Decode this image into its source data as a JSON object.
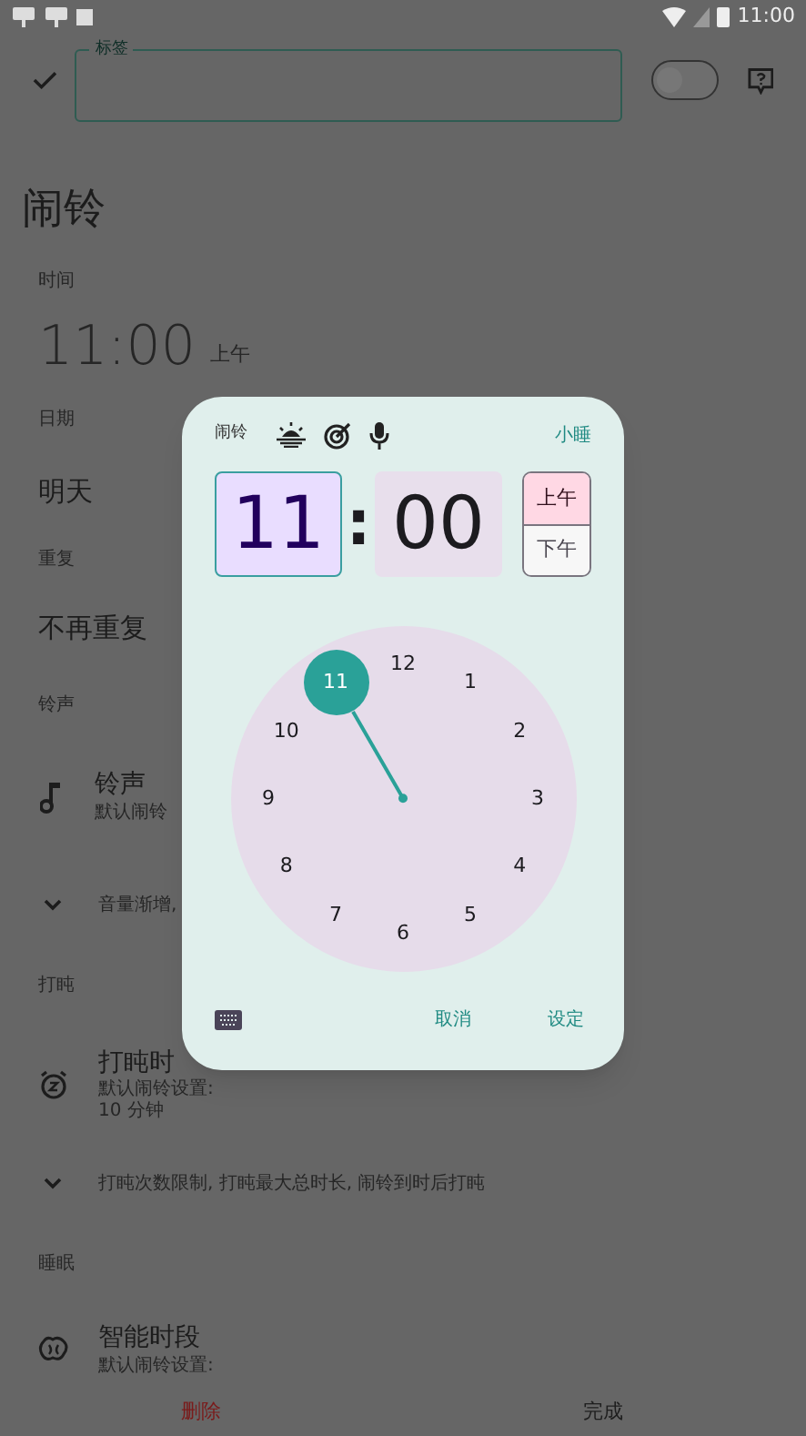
{
  "status_bar": {
    "time": "11:00"
  },
  "label_field": {
    "label": "标签"
  },
  "toggle": {
    "on": false
  },
  "title": "闹铃",
  "time": {
    "header": "时间",
    "value": "11:00",
    "period": "上午"
  },
  "date": {
    "header": "日期",
    "value": "明天"
  },
  "repeat": {
    "header": "重复",
    "value": "不再重复"
  },
  "ringtone": {
    "header": "铃声",
    "title": "铃声",
    "subtitle": "默认闹铃",
    "more": "音量渐增,"
  },
  "snooze": {
    "header": "打盹",
    "title": "打盹时",
    "subtitle_lines": [
      "默认闹铃设置:",
      "10 分钟"
    ],
    "more": "打盹次数限制, 打盹最大总时长, 闹铃到时后打盹"
  },
  "sleep": {
    "header": "睡眠",
    "title": "智能时段",
    "subtitle": "默认闹铃设置:"
  },
  "bottom": {
    "delete": "删除",
    "done": "完成"
  },
  "dialog": {
    "title": "闹铃",
    "snooze": "小睡",
    "hour": {
      "value": "11",
      "selected": true
    },
    "separator": ":",
    "minute": {
      "value": "00",
      "selected": false
    },
    "periods": [
      {
        "label": "上午",
        "selected": true
      },
      {
        "label": "下午",
        "selected": false
      }
    ],
    "dial": [
      {
        "label": "12",
        "selected": false
      },
      {
        "label": "1",
        "selected": false
      },
      {
        "label": "2",
        "selected": false
      },
      {
        "label": "3",
        "selected": false
      },
      {
        "label": "4",
        "selected": false
      },
      {
        "label": "5",
        "selected": false
      },
      {
        "label": "6",
        "selected": false
      },
      {
        "label": "7",
        "selected": false
      },
      {
        "label": "8",
        "selected": false
      },
      {
        "label": "9",
        "selected": false
      },
      {
        "label": "10",
        "selected": false
      },
      {
        "label": "11",
        "selected": true
      }
    ],
    "cancel": "取消",
    "confirm": "设定"
  }
}
